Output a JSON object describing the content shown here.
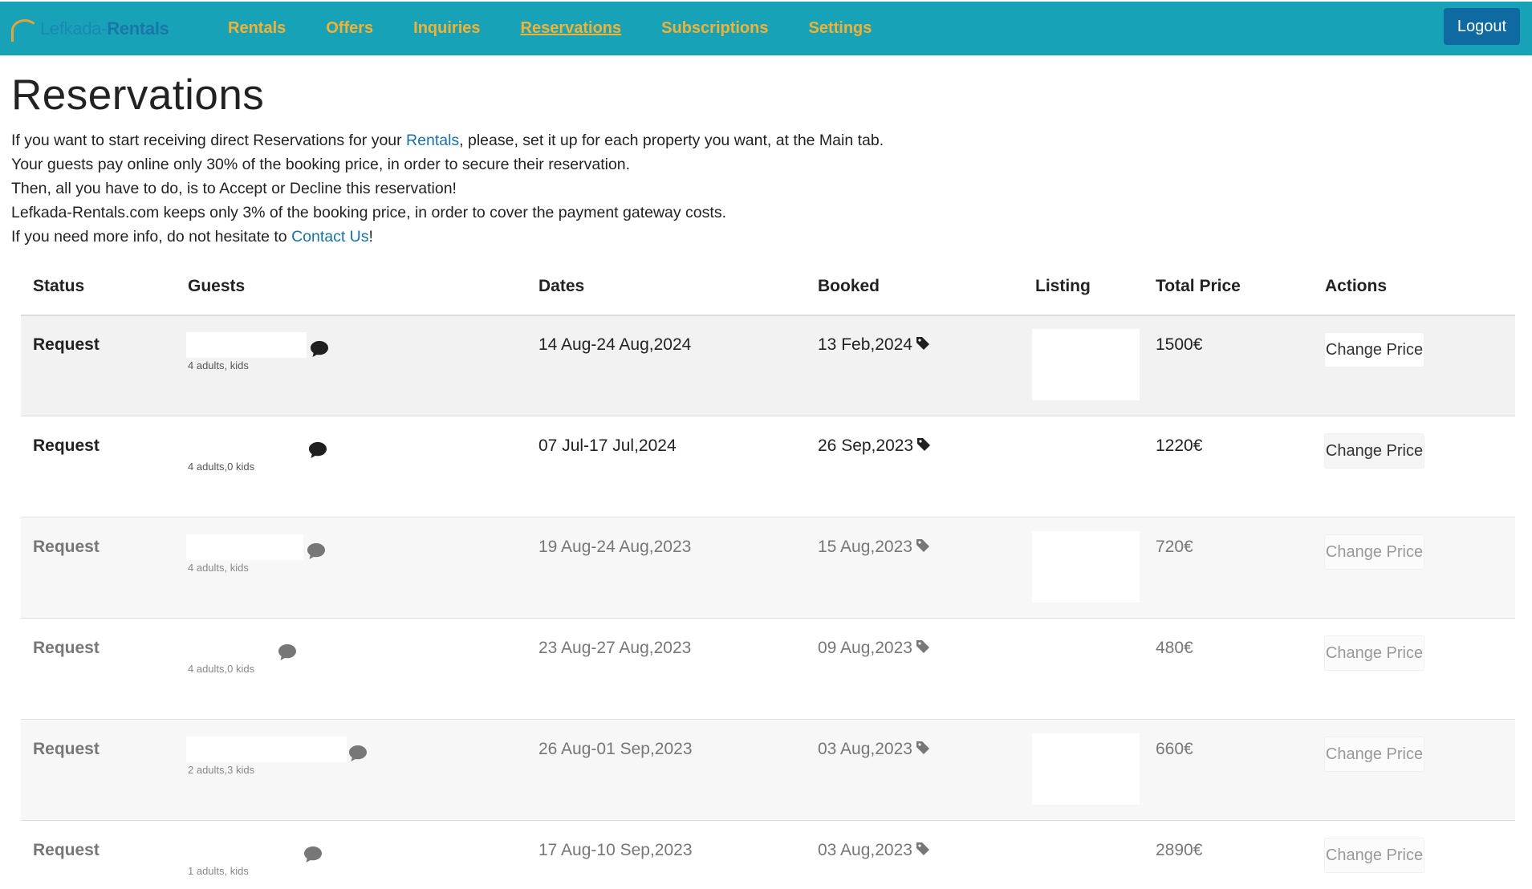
{
  "nav": {
    "brand_part1": "Lefkada-",
    "brand_part2": "Rentals",
    "links": [
      {
        "label": "Rentals",
        "active": false
      },
      {
        "label": "Offers",
        "active": false
      },
      {
        "label": "Inquiries",
        "active": false
      },
      {
        "label": "Reservations",
        "active": true
      },
      {
        "label": "Subscriptions",
        "active": false
      },
      {
        "label": "Settings",
        "active": false
      }
    ],
    "logout_label": "Logout"
  },
  "page": {
    "title": "Reservations",
    "intro": {
      "l1_pre": "If you want to start receiving direct Reservations for your ",
      "l1_link": "Rentals",
      "l1_post": ", please, set it up for each property you want, at the Main tab.",
      "l2": "Your guests pay online only 30% of the booking price, in order to secure their reservation.",
      "l3": "Then, all you have to do, is to Accept or Decline this reservation!",
      "l4": "Lefkada-Rentals.com keeps only 3% of the booking price, in order to cover the payment gateway costs.",
      "l5_pre": "If you need more info, do not hesitate to ",
      "l5_link": "Contact Us",
      "l5_post": "!"
    }
  },
  "table": {
    "headers": {
      "status": "Status",
      "guests": "Guests",
      "dates": "Dates",
      "booked": "Booked",
      "listing": "Listing",
      "total": "Total Price",
      "actions": "Actions"
    },
    "rows": [
      {
        "status": "Request",
        "guests": "4 adults, kids",
        "dates": "14 Aug-24 Aug,2024",
        "booked": "13 Feb,2024",
        "price": "1500€",
        "action": "Change Price"
      },
      {
        "status": "Request",
        "guests": "4 adults,0 kids",
        "dates": "07 Jul-17 Jul,2024",
        "booked": "26 Sep,2023",
        "price": "1220€",
        "action": "Change Price"
      },
      {
        "status": "Request",
        "guests": "4 adults, kids",
        "dates": "19 Aug-24 Aug,2023",
        "booked": "15 Aug,2023",
        "price": "720€",
        "action": "Change Price"
      },
      {
        "status": "Request",
        "guests": "4 adults,0 kids",
        "dates": "23 Aug-27 Aug,2023",
        "booked": "09 Aug,2023",
        "price": "480€",
        "action": "Change Price"
      },
      {
        "status": "Request",
        "guests": "2 adults,3 kids",
        "dates": "26 Aug-01 Sep,2023",
        "booked": "03 Aug,2023",
        "price": "660€",
        "action": "Change Price"
      },
      {
        "status": "Request",
        "guests": "1 adults, kids",
        "dates": "17 Aug-10 Sep,2023",
        "booked": "03 Aug,2023",
        "price": "2890€",
        "action": "Change Price"
      }
    ]
  },
  "icons": {
    "chat": "chat-bubble-icon",
    "tag": "price-tag-icon"
  },
  "colors": {
    "navbar": "#18a2b8",
    "nav_link": "#f2b233",
    "logout": "#0e6aa0",
    "link": "#1a70a6"
  }
}
